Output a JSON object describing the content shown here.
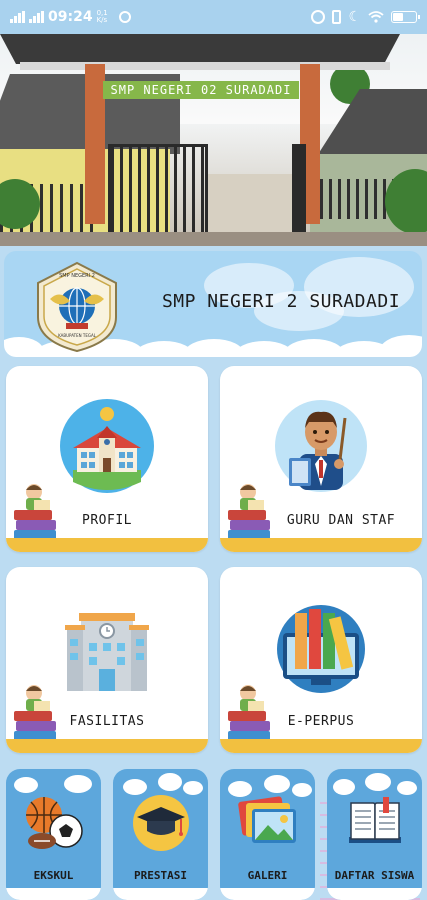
{
  "status_bar": {
    "time": "09:24",
    "net_speed": "0,1 K/s",
    "signal_label_1": "4G",
    "signal_label_2": "4G",
    "battery_level": 0.4
  },
  "header_photo": {
    "sign_text": "SMP NEGERI 02 SURADADI"
  },
  "banner": {
    "title": "SMP NEGERI 2 SURADADI",
    "logo_top_text": "SMP NEGERI 2",
    "logo_bottom_text": "KABUPATEN TEGAL"
  },
  "menu": {
    "profil": "PROFIL",
    "guru": "GURU DAN STAF",
    "fasilitas": "FASILITAS",
    "eperpus": "E-PERPUS"
  },
  "bottom_menu": {
    "ekskul": "EKSKUL",
    "prestasi": "PRESTASI",
    "galeri": "GALERI",
    "daftar_siswa": "DAFTAR SISWA"
  },
  "colors": {
    "accent_yellow": "#f2c040",
    "banner_blue": "#a9d6f3",
    "mini_blue": "#5da7dc",
    "page_bg": "#bcdcf2"
  },
  "icons": {
    "profil": "school-building-icon",
    "guru": "teacher-icon",
    "fasilitas": "building-icon",
    "eperpus": "books-monitor-icon",
    "ekskul": "sports-balls-icon",
    "prestasi": "graduation-cap-icon",
    "galeri": "photo-gallery-icon",
    "daftar_siswa": "open-book-icon"
  }
}
